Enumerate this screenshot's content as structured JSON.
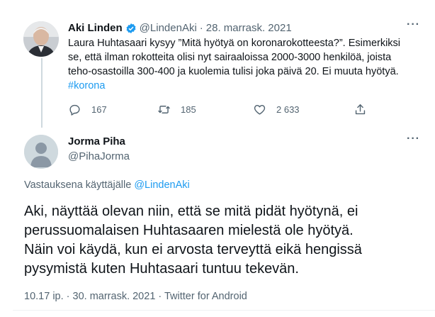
{
  "parent_tweet": {
    "author_name": "Aki Linden",
    "handle": "@LindenAki",
    "separator": "·",
    "date": "28. marrask. 2021",
    "more_label": "···",
    "text_lines": [
      "Laura Huhtasaari kysyy ”Mitä hyötyä on koronarokotteesta?”. Esimerkiksi",
      "se, että ilman rokotteita olisi nyt sairaaloissa 2000-3000 henkilöä, joista",
      "teho-osastoilla 300-400 ja kuolemia tulisi joka päivä 20. Ei muuta hyötyä."
    ],
    "hashtag": "#korona",
    "replies": "167",
    "retweets": "185",
    "likes": "2 633"
  },
  "reply_tweet": {
    "author_name": "Jorma Piha",
    "handle": "@PihaJorma",
    "more_label": "···",
    "replying_prefix": "Vastauksena käyttäjälle",
    "replying_to": "@LindenAki",
    "text_lines": [
      "Aki, näyttää olevan niin, että se mitä pidät hyötynä, ei",
      "perussuomalaisen Huhtasaaren mielestä ole hyötyä.",
      "Näin voi käydä, kun ei arvosta terveyttä eikä hengissä",
      "pysymistä kuten Huhtasaari tuntuu tekevän."
    ],
    "timestamp": "10.17 ip. · 30. marrask. 2021 · Twitter for Android"
  },
  "colors": {
    "accent": "#1d9bf0",
    "muted": "#536471",
    "text": "#0f1419",
    "divider": "#eff3f4"
  }
}
